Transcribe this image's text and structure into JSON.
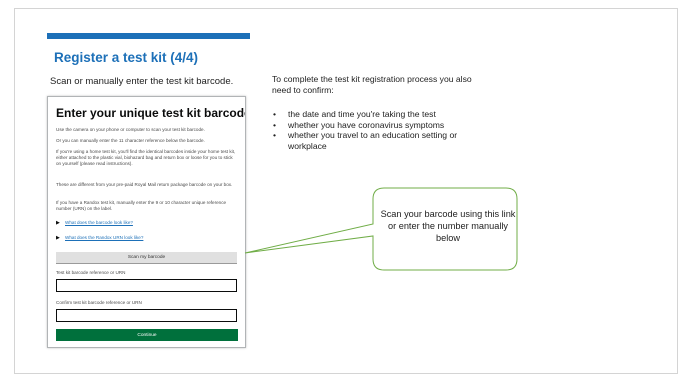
{
  "page": {
    "title": "Register a test kit (4/4)",
    "subtitle": "Scan or manually enter the test kit barcode.",
    "intro": "To complete the test kit registration process you also need to confirm:",
    "confirm_list": [
      "the date and time you're taking the test",
      "whether you have coronavirus symptoms",
      "whether you travel to an education setting or workplace"
    ]
  },
  "card": {
    "heading": "Enter your unique test kit barcode",
    "p1": "Use the camera on your phone or computer to scan your test kit barcode.",
    "p2": "Or you can manually enter the 11 character reference below the barcode.",
    "p3": "If you're using a home test kit, you'll find the identical barcodes inside your home test kit, either attached to the plastic vial, biohazard bag and return box or loose for you to stick on yourself (please read instructions).",
    "p4": "These are different from your pre-paid Royal Mail return package barcode on your box.",
    "p5": "If you have a Randox test kit, manually enter the 9 or 10 character unique reference number (URN) on the label.",
    "link1": "What does the barcode look like?",
    "link2": "What does the Randox URN look like?",
    "scan_button": "Scan my barcode",
    "field1_label": "Test kit barcode reference or URN",
    "field1_value": "",
    "field2_label": "Confirm test kit barcode reference or URN",
    "field2_value": "",
    "continue_button": "Continue"
  },
  "callout": {
    "text": "Scan your barcode using this link or enter the number manually below"
  },
  "colors": {
    "brand_blue": "#1d70b8",
    "continue_green": "#00703c",
    "callout_border": "#70ad47"
  }
}
